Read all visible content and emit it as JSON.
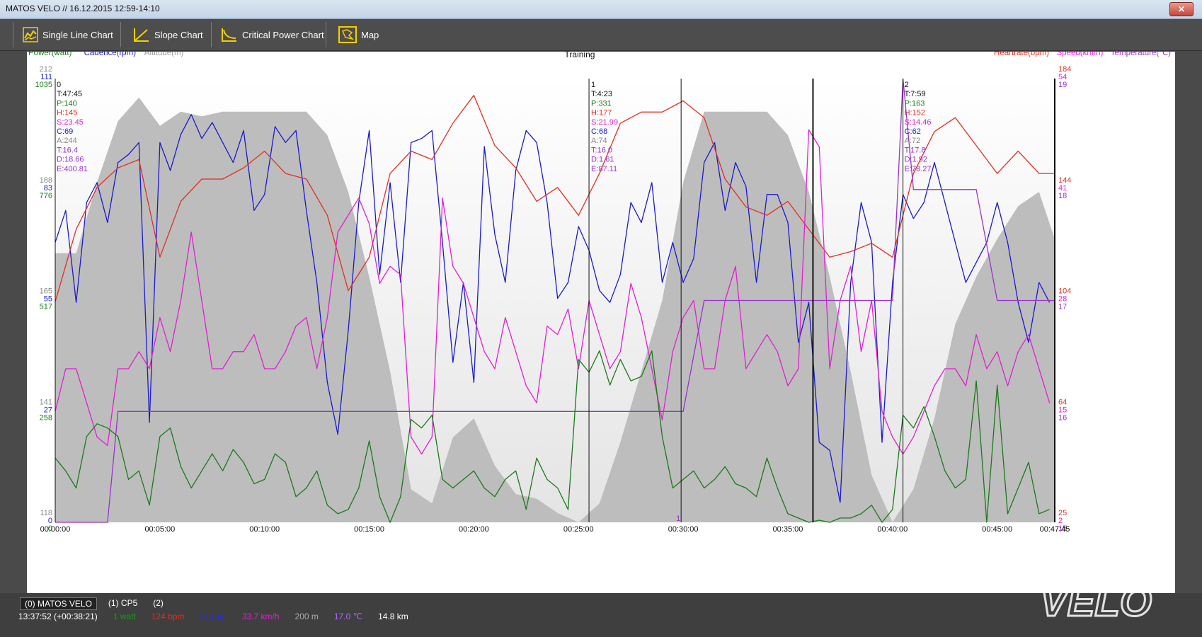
{
  "window": {
    "title": "MATOS VELO // 16.12.2015 12:59-14:10",
    "close_icon": "close-icon"
  },
  "toolbar": {
    "buttons": [
      {
        "label": "Single Line Chart",
        "icon": "line-chart-icon"
      },
      {
        "label": "Slope Chart",
        "icon": "slope-chart-icon"
      },
      {
        "label": "Critical Power Chart",
        "icon": "critical-power-icon"
      },
      {
        "label": "Map",
        "icon": "map-icon"
      }
    ]
  },
  "chart": {
    "title": "Training",
    "legend_left": [
      {
        "label": "Power(watt)",
        "color": "#1a7a1a"
      },
      {
        "label": "Cadence(rpm)",
        "color": "#1a1acc"
      },
      {
        "label": "Altitude(m)",
        "color": "#999999"
      }
    ],
    "legend_right": [
      {
        "label": "Heartrate(bpm)",
        "color": "#e03020"
      },
      {
        "label": "Speed(km/h)",
        "color": "#e020d0"
      },
      {
        "label": "Temperature(℃)",
        "color": "#9933cc"
      }
    ],
    "y_left": [
      {
        "alt": "212",
        "cad": "111",
        "pow": "1035"
      },
      {
        "alt": "188",
        "cad": "83",
        "pow": "776"
      },
      {
        "alt": "165",
        "cad": "55",
        "pow": "517"
      },
      {
        "alt": "141",
        "cad": "27",
        "pow": "258"
      },
      {
        "alt": "118",
        "cad": "0",
        "pow": "0"
      }
    ],
    "y_right": [
      {
        "hr": "184",
        "spd": "54",
        "temp": "19"
      },
      {
        "hr": "144",
        "spd": "41",
        "temp": "18"
      },
      {
        "hr": "104",
        "spd": "28",
        "temp": "17"
      },
      {
        "hr": "64",
        "spd": "15",
        "temp": "16"
      },
      {
        "hr": "25",
        "spd": "2",
        "temp": "15"
      }
    ],
    "x_ticks": [
      "00:00:00",
      "00:05:00",
      "00:10:00",
      "00:15:00",
      "00:20:00",
      "00:25:00",
      "00:30:00",
      "00:35:00",
      "00:40:00",
      "00:45:00",
      "00:47:45"
    ],
    "laps": [
      {
        "id": "0",
        "t": "T:47:45",
        "p": "P:140",
        "h": "H:145",
        "s": "S:23.45",
        "c": "C:69",
        "a": "A:244",
        "temp": "T:16.4",
        "d": "D:18.66",
        "e": "E:400.81"
      },
      {
        "id": "1",
        "t": "T:4:23",
        "p": "P:331",
        "h": "H:177",
        "s": "S:21.99",
        "c": "C:68",
        "a": "A:74",
        "temp": "T:16.0",
        "d": "D:1.61",
        "e": "E:87.11"
      },
      {
        "id": "2",
        "t": "T:7:59",
        "p": "P:163",
        "h": "H:152",
        "s": "S:14.46",
        "c": "C:62",
        "a": "A:72",
        "temp": "T:17.8",
        "d": "D:1.92",
        "e": "E:78.27"
      }
    ],
    "marker_label": "1"
  },
  "chart_data": {
    "type": "line",
    "title": "Training",
    "x_range_minutes": [
      0,
      47.75
    ],
    "series": [
      {
        "name": "Altitude(m)",
        "color": "#bdbdbd",
        "ylim": [
          118,
          212
        ],
        "x": [
          0,
          1,
          2,
          3,
          4,
          5,
          6,
          7,
          8,
          9,
          10,
          11,
          12,
          13,
          14,
          15,
          16,
          17,
          18,
          19,
          20,
          21,
          22,
          23,
          24,
          25,
          26,
          27,
          28,
          29,
          30,
          31,
          32,
          33,
          34,
          35,
          36,
          37,
          38,
          39,
          40,
          41,
          42,
          43,
          44,
          45,
          46,
          47,
          47.75
        ],
        "y": [
          175,
          175,
          190,
          203,
          208,
          202,
          205,
          204,
          205,
          205,
          205,
          205,
          205,
          200,
          188,
          170,
          150,
          125,
          122,
          136,
          140,
          130,
          124,
          123,
          120,
          118,
          122,
          135,
          150,
          165,
          190,
          205,
          205,
          205,
          205,
          200,
          188,
          170,
          150,
          128,
          118,
          125,
          140,
          160,
          170,
          178,
          185,
          188,
          178
        ]
      },
      {
        "name": "Cadence(rpm)",
        "color": "#1a1acc",
        "ylim": [
          0,
          111
        ],
        "x": [
          0,
          0.5,
          1,
          1.5,
          2,
          2.5,
          3,
          3.5,
          4,
          4.5,
          5,
          5.5,
          6,
          6.5,
          7,
          7.5,
          8,
          8.5,
          9,
          9.5,
          10,
          10.5,
          11,
          11.5,
          12,
          12.5,
          13,
          13.5,
          14,
          14.5,
          15,
          15.5,
          16,
          16.5,
          17,
          17.5,
          18,
          18.5,
          19,
          19.5,
          20,
          20.5,
          21,
          21.5,
          22,
          22.5,
          23,
          23.5,
          24,
          24.5,
          25,
          25.5,
          26,
          26.5,
          27,
          27.5,
          28,
          28.5,
          29,
          29.5,
          30,
          30.5,
          31,
          31.5,
          32,
          32.5,
          33,
          33.5,
          34,
          34.5,
          35,
          35.5,
          36,
          36.5,
          37,
          37.5,
          38,
          38.5,
          39,
          39.5,
          40,
          40.5,
          41,
          41.5,
          42,
          42.5,
          43,
          43.5,
          44,
          44.5,
          45,
          45.5,
          46,
          46.5,
          47,
          47.5
        ],
        "y": [
          70,
          78,
          55,
          80,
          85,
          75,
          90,
          92,
          95,
          25,
          95,
          88,
          97,
          102,
          96,
          100,
          95,
          90,
          98,
          78,
          82,
          99,
          95,
          98,
          78,
          60,
          35,
          22,
          48,
          80,
          98,
          62,
          85,
          60,
          95,
          96,
          98,
          70,
          40,
          60,
          35,
          94,
          72,
          60,
          88,
          98,
          95,
          80,
          56,
          60,
          74,
          68,
          58,
          55,
          62,
          80,
          75,
          85,
          60,
          70,
          60,
          66,
          90,
          95,
          78,
          90,
          84,
          60,
          82,
          82,
          75,
          45,
          55,
          20,
          18,
          5,
          60,
          80,
          70,
          20,
          60,
          82,
          76,
          80,
          90,
          80,
          70,
          60,
          65,
          70,
          80,
          70,
          55,
          45,
          60,
          55
        ]
      },
      {
        "name": "Heartrate(bpm)",
        "color": "#e03020",
        "ylim": [
          25,
          184
        ],
        "x": [
          0,
          1,
          2,
          3,
          4,
          5,
          6,
          7,
          8,
          9,
          10,
          11,
          12,
          13,
          14,
          15,
          16,
          17,
          18,
          19,
          20,
          21,
          22,
          23,
          24,
          25,
          26,
          27,
          28,
          29,
          30,
          31,
          32,
          33,
          34,
          35,
          36,
          37,
          38,
          39,
          40,
          41,
          42,
          43,
          44,
          45,
          46,
          47,
          47.75
        ],
        "y": [
          104,
          130,
          145,
          152,
          155,
          120,
          140,
          148,
          148,
          152,
          158,
          150,
          148,
          135,
          108,
          120,
          150,
          158,
          155,
          168,
          178,
          160,
          152,
          140,
          145,
          135,
          150,
          168,
          172,
          172,
          176,
          170,
          148,
          138,
          135,
          140,
          130,
          120,
          122,
          125,
          120,
          150,
          165,
          170,
          160,
          150,
          158,
          150,
          150
        ]
      },
      {
        "name": "Speed(km/h)",
        "color": "#e020d0",
        "ylim": [
          2,
          54
        ],
        "x": [
          0,
          0.5,
          1,
          1.5,
          2,
          2.5,
          3,
          3.5,
          4,
          4.5,
          5,
          5.5,
          6,
          6.5,
          7,
          7.5,
          8,
          8.5,
          9,
          9.5,
          10,
          10.5,
          11,
          11.5,
          12,
          12.5,
          13,
          13.5,
          14,
          14.5,
          15,
          15.5,
          16,
          16.5,
          17,
          17.5,
          18,
          18.5,
          19,
          19.5,
          20,
          20.5,
          21,
          21.5,
          22,
          22.5,
          23,
          23.5,
          24,
          24.5,
          25,
          25.5,
          26,
          26.5,
          27,
          27.5,
          28,
          28.5,
          29,
          29.5,
          30,
          30.5,
          31,
          31.5,
          32,
          32.5,
          33,
          33.5,
          34,
          34.5,
          35,
          35.5,
          36,
          36.5,
          37,
          37.5,
          38,
          38.5,
          39,
          39.5,
          40,
          40.5,
          41,
          41.5,
          42,
          42.5,
          43,
          43.5,
          44,
          44.5,
          45,
          45.5,
          46,
          46.5,
          47,
          47.5
        ],
        "y": [
          15,
          20,
          20,
          16,
          12,
          11,
          20,
          20,
          22,
          20,
          26,
          22,
          28,
          36,
          28,
          20,
          20,
          22,
          22,
          24,
          20,
          20,
          22,
          25,
          26,
          20,
          26,
          36,
          38,
          40,
          37,
          30,
          32,
          31,
          12,
          10,
          12,
          40,
          32,
          30,
          26,
          22,
          20,
          26,
          22,
          18,
          16,
          25,
          24,
          27,
          20,
          28,
          24,
          20,
          22,
          30,
          26,
          20,
          14,
          22,
          26,
          28,
          20,
          20,
          28,
          32,
          20,
          22,
          24,
          22,
          18,
          20,
          48,
          46,
          20,
          28,
          32,
          22,
          28,
          15,
          12,
          10,
          12,
          15,
          18,
          20,
          20,
          18,
          24,
          20,
          22,
          18,
          22,
          24,
          20,
          16
        ]
      },
      {
        "name": "Temperature(℃)",
        "color": "#9933cc",
        "ylim": [
          15,
          19
        ],
        "x": [
          0,
          2.5,
          3,
          24,
          30,
          31,
          40,
          40.5,
          41,
          44,
          45,
          47.75
        ],
        "y": [
          15,
          15,
          16,
          16,
          16,
          17,
          17,
          19,
          18,
          18,
          17,
          17
        ]
      },
      {
        "name": "Power(watt)",
        "color": "#1a7a1a",
        "ylim": [
          0,
          1035
        ],
        "x": [
          0,
          0.5,
          1,
          1.5,
          2,
          2.5,
          3,
          3.5,
          4,
          4.5,
          5,
          5.5,
          6,
          6.5,
          7,
          7.5,
          8,
          8.5,
          9,
          9.5,
          10,
          10.5,
          11,
          11.5,
          12,
          12.5,
          13,
          13.5,
          14,
          14.5,
          15,
          15.5,
          16,
          16.5,
          17,
          17.5,
          18,
          18.5,
          19,
          19.5,
          20,
          20.5,
          21,
          21.5,
          22,
          22.5,
          23,
          23.5,
          24,
          24.5,
          25,
          25.5,
          26,
          26.5,
          27,
          27.5,
          28,
          28.5,
          29,
          29.5,
          30,
          30.5,
          31,
          31.5,
          32,
          32.5,
          33,
          33.5,
          34,
          34.5,
          35,
          35.5,
          36,
          36.5,
          37,
          37.5,
          38,
          38.5,
          39,
          39.5,
          40,
          40.5,
          41,
          41.5,
          42,
          42.5,
          43,
          43.5,
          44,
          44.5,
          45,
          45.5,
          46,
          46.5,
          47,
          47.5
        ],
        "y": [
          150,
          120,
          80,
          200,
          230,
          220,
          200,
          100,
          120,
          40,
          200,
          220,
          130,
          80,
          120,
          160,
          120,
          170,
          140,
          90,
          100,
          160,
          140,
          60,
          80,
          120,
          40,
          20,
          30,
          80,
          190,
          60,
          0,
          60,
          240,
          220,
          250,
          100,
          80,
          100,
          120,
          80,
          60,
          100,
          120,
          30,
          150,
          100,
          80,
          30,
          380,
          350,
          400,
          320,
          380,
          330,
          340,
          400,
          200,
          80,
          100,
          120,
          80,
          100,
          130,
          90,
          80,
          60,
          150,
          80,
          20,
          10,
          0,
          5,
          0,
          10,
          10,
          20,
          40,
          0,
          30,
          250,
          220,
          270,
          200,
          120,
          80,
          100,
          330,
          0,
          320,
          20,
          80,
          140,
          20,
          30
        ]
      }
    ],
    "laps_x_minutes": [
      25.5,
      29.9,
      36.2,
      40.5
    ],
    "lap_rule_x_minutes": 47.75
  },
  "statusbar": {
    "tabs": [
      "(0) MATOS VELO",
      "(1) CP5",
      "(2)"
    ],
    "time": "13:37:52 (+00:38:21)",
    "readouts": [
      {
        "text": "1 watt",
        "color": "#1a9a1a"
      },
      {
        "text": "124 bpm",
        "color": "#e03020"
      },
      {
        "text": "61 rpm",
        "color": "#2a2aee"
      },
      {
        "text": "33.7 km/h",
        "color": "#e020d0"
      },
      {
        "text": "200 m",
        "color": "#aaaaaa"
      },
      {
        "text": "17.0 ℃",
        "color": "#b466ff"
      },
      {
        "text": "14.8 km",
        "color": "#ffffff"
      }
    ]
  },
  "watermark": "MATOS VELO logo"
}
